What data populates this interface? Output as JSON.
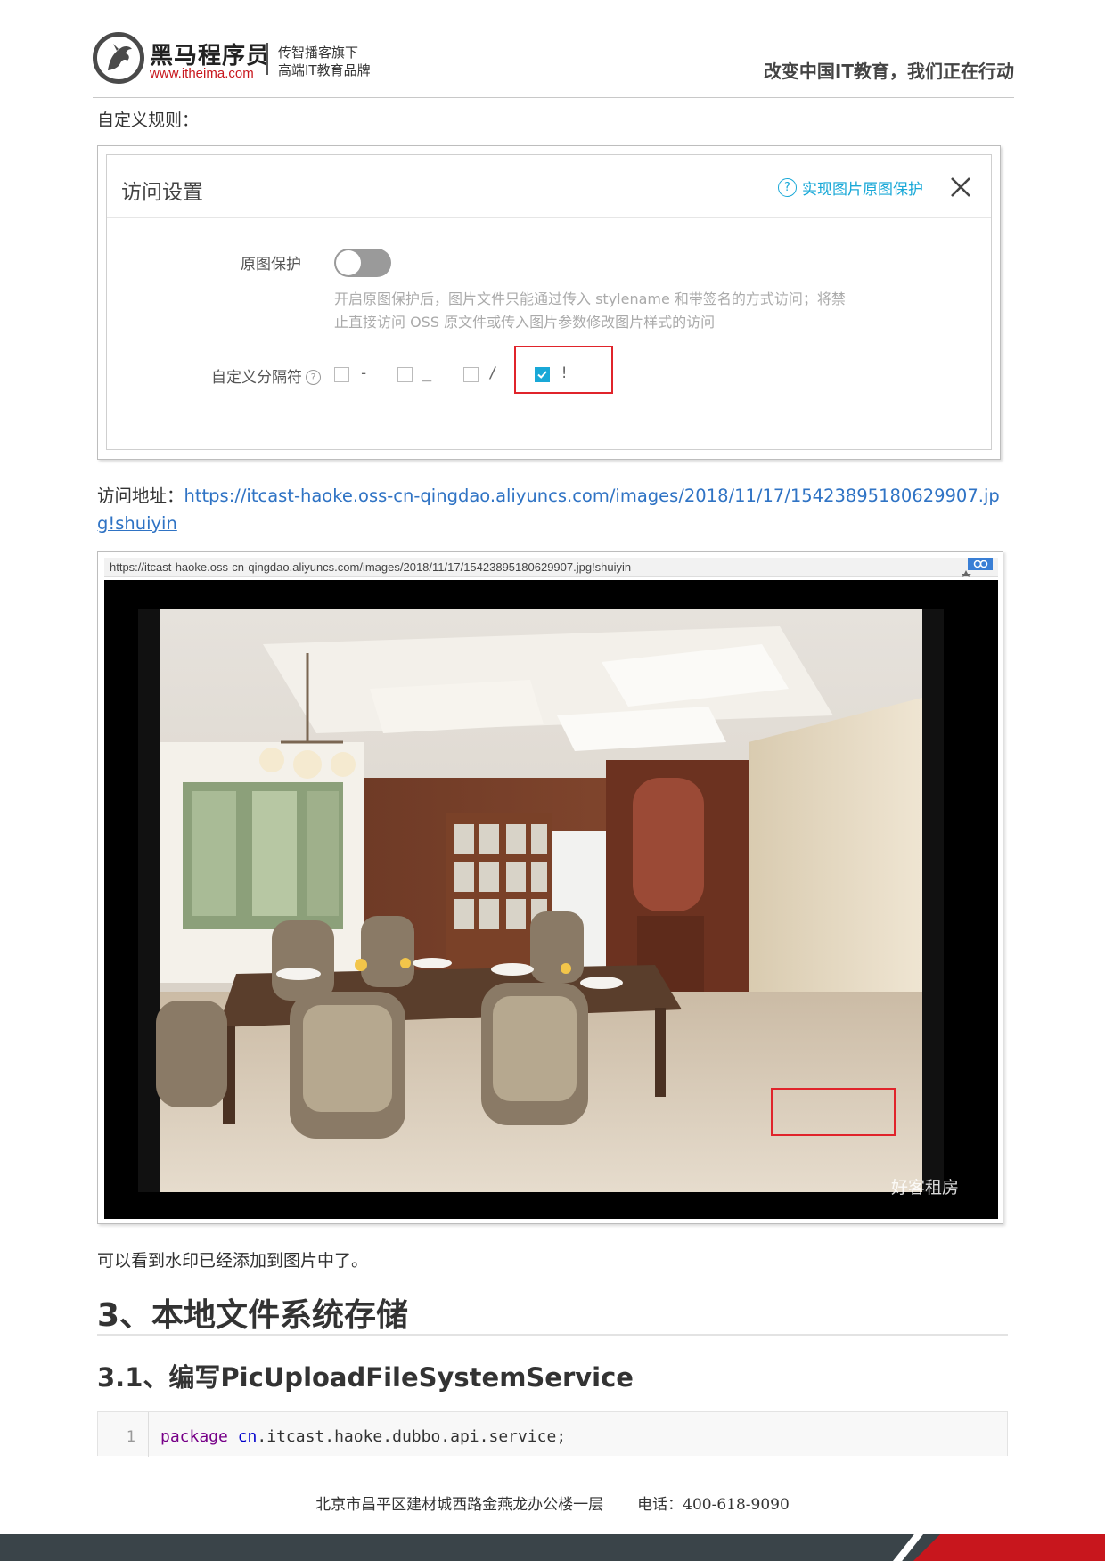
{
  "header": {
    "logo_name": "黑马程序员",
    "logo_url": "www.itheima.com",
    "tagline_1": "传智播客旗下",
    "tagline_2": "高端IT教育品牌",
    "slogan": "改变中国IT教育，我们正在行动"
  },
  "intro_label": "自定义规则：",
  "dialog": {
    "title": "访问设置",
    "help_link": "实现图片原图保护",
    "help_icon": "?",
    "protect_label": "原图保护",
    "protect_enabled": false,
    "protect_desc_1": "开启原图保护后，图片文件只能通过传入 stylename 和带签名的方式访问；将禁",
    "protect_desc_2": "止直接访问 OSS 原文件或传入图片参数修改图片样式的访问",
    "separator_label": "自定义分隔符",
    "separator_help_icon": "?",
    "separators": [
      {
        "symbol": "-",
        "checked": false
      },
      {
        "symbol": "_",
        "checked": false
      },
      {
        "symbol": "/",
        "checked": false
      },
      {
        "symbol": "!",
        "checked": true
      }
    ],
    "highlight_color": "#e0242b",
    "accent_color": "#19a8d7"
  },
  "access": {
    "label": "访问地址：",
    "url": "https://itcast-haoke.oss-cn-qingdao.aliyuncs.com/images/2018/11/17/15423895180629907.jpg!shuiyin"
  },
  "browser": {
    "address": "https://itcast-haoke.oss-cn-qingdao.aliyuncs.com/images/2018/11/17/15423895180629907.jpg!shuiyin",
    "watermark": "好客租房"
  },
  "note": "可以看到水印已经添加到图片中了。",
  "section_heading": "3、本地文件系统存储",
  "subsection_heading": "3.1、编写PicUploadFileSystemService",
  "code": {
    "line_number": "1",
    "keyword": "package",
    "package_root": "cn",
    "package_rest": ".itcast.haoke.dubbo.api.service;"
  },
  "footer": {
    "address": "北京市昌平区建材城西路金燕龙办公楼一层",
    "phone": "电话：400-618-9090"
  }
}
